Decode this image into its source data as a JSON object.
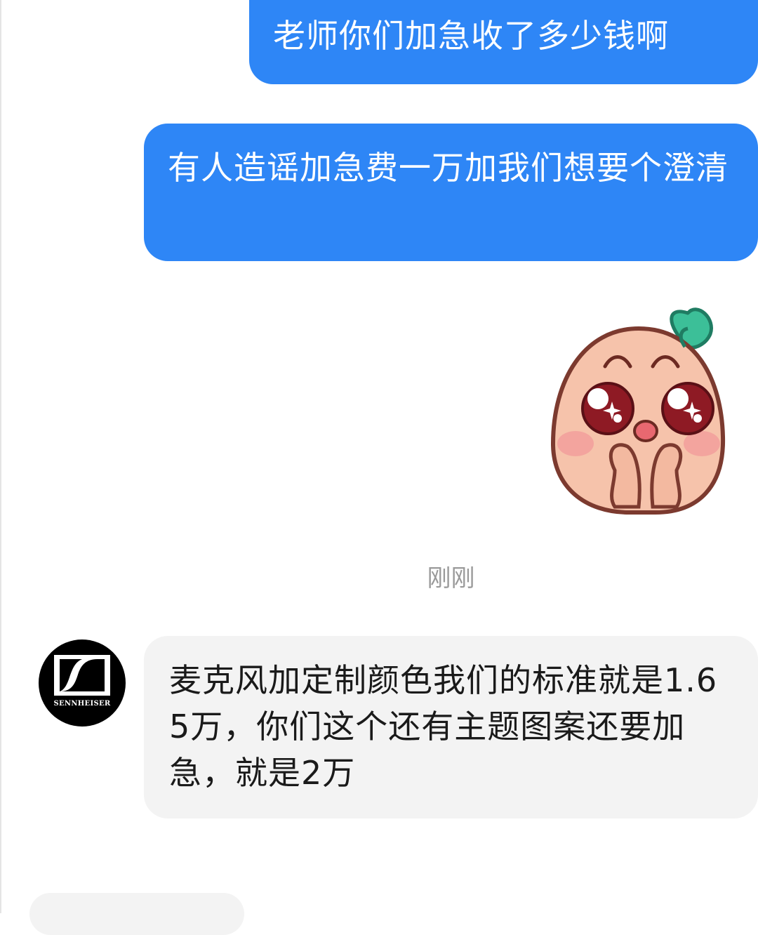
{
  "messages": [
    {
      "direction": "outgoing",
      "type": "text",
      "text": "老师你们加急收了多少钱啊"
    },
    {
      "direction": "outgoing",
      "type": "text",
      "text": "有人造谣加急费一万加我们想要个澄清"
    },
    {
      "direction": "outgoing",
      "type": "sticker",
      "sticker": "pleading-peach-sticker"
    },
    {
      "direction": "incoming",
      "type": "text",
      "text": "麦克风加定制颜色我们的标准就是1.65万，你们这个还有主题图案还要加急，就是2万"
    }
  ],
  "timestamp": "刚刚",
  "contact": {
    "avatar_brand": "SENNHEISER"
  },
  "colors": {
    "outgoing_bubble": "#2e86f6",
    "incoming_bubble": "#f3f3f3",
    "timestamp_text": "#9a9a9a"
  }
}
